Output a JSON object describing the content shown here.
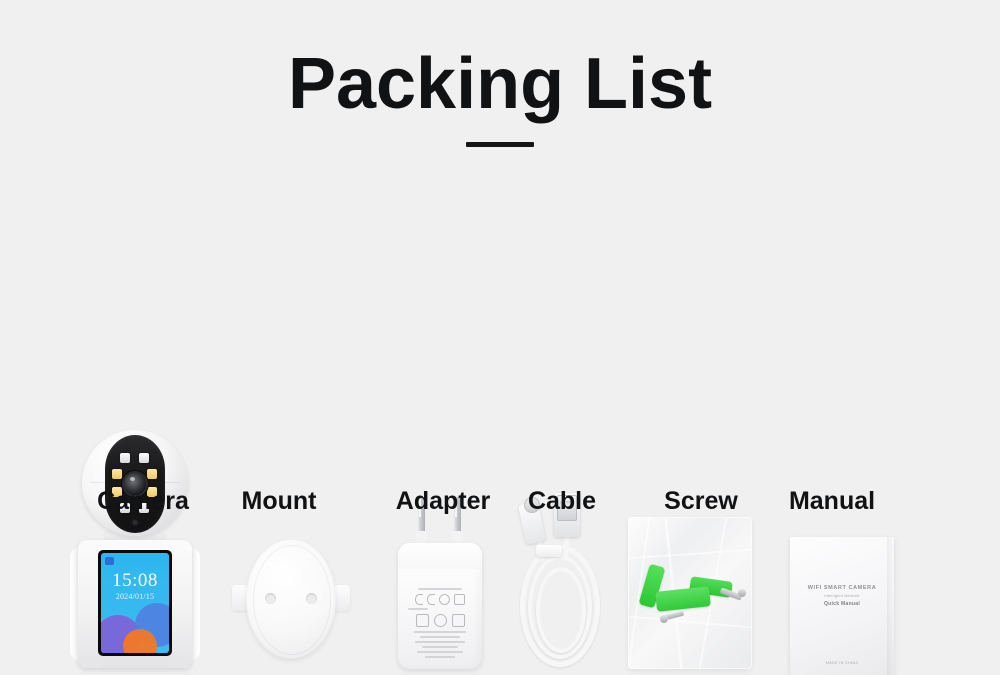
{
  "page": {
    "background_color": "#f1f0f0",
    "title": "Packing List",
    "accent_rule_color": "#151515"
  },
  "items": [
    {
      "id": "camera",
      "label": "Camera",
      "icon": "wifi-camera-icon",
      "screen": {
        "time": "15:08",
        "date": "2024/01/15",
        "background_color": "#36b9ef",
        "blob_colors": [
          "#7b63d8",
          "#f0792a",
          "#4f7fe0"
        ]
      }
    },
    {
      "id": "mount",
      "label": "Mount",
      "icon": "wall-mount-bracket-icon"
    },
    {
      "id": "adapter",
      "label": "Adapter",
      "icon": "eu-power-adapter-icon"
    },
    {
      "id": "cable",
      "label": "Cable",
      "icon": "usb-cable-icon"
    },
    {
      "id": "screw",
      "label": "Screw",
      "icon": "screw-bag-icon",
      "anchor_color": "#3ad83f"
    },
    {
      "id": "manual",
      "label": "Manual",
      "icon": "manual-booklet-icon",
      "cover": {
        "title": "WIFI SMART CAMERA",
        "subtitle": "Intelligent Network",
        "heading": "Quick Manual",
        "footer": "MADE IN CHINA"
      }
    }
  ]
}
